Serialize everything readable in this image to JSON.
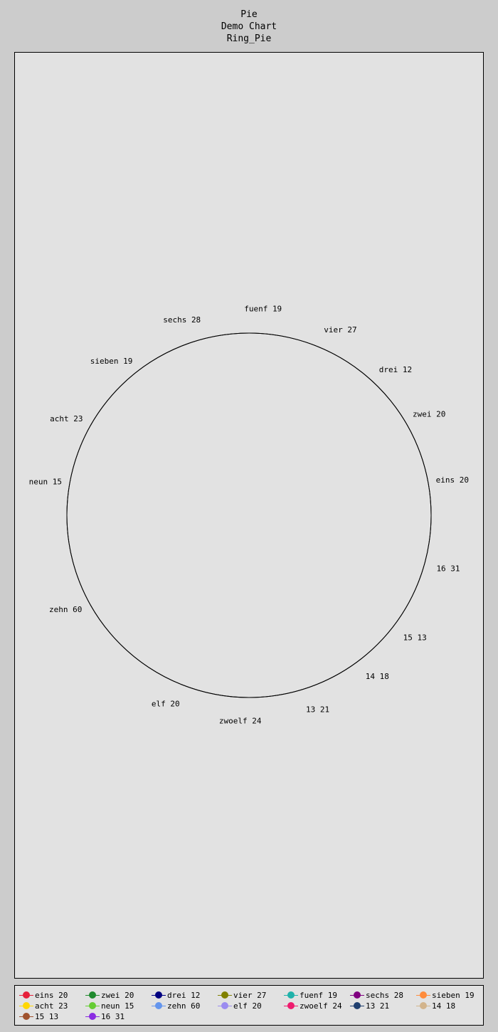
{
  "chart_data": {
    "type": "pie",
    "title": "Pie",
    "subtitle": [
      "Demo Chart",
      "Ring_Pie"
    ],
    "ring": true,
    "categories": [
      "eins",
      "zwei",
      "drei",
      "vier",
      "fuenf",
      "sechs",
      "sieben",
      "acht",
      "neun",
      "zehn",
      "elf",
      "zwoelf",
      "13",
      "14",
      "15",
      "16"
    ],
    "values": [
      20,
      20,
      12,
      27,
      19,
      28,
      19,
      23,
      15,
      60,
      20,
      24,
      21,
      18,
      13,
      31
    ],
    "labels": [
      "eins 20",
      "zwei 20",
      "drei 12",
      "vier 27",
      "fuenf 19",
      "sechs 28",
      "sieben 19",
      "acht 23",
      "neun 15",
      "zehn 60",
      "elf 20",
      "zwoelf 24",
      "13 21",
      "14 18",
      "15 13",
      "16 31"
    ],
    "colors": [
      "#e6203a",
      "#1f8a2e",
      "#000080",
      "#808000",
      "#20b2aa",
      "#800080",
      "#ff8c3c",
      "#ffd700",
      "#66cc33",
      "#6495ed",
      "#9b8cf0",
      "#ee1c6e",
      "#1f3f6f",
      "#d2b48c",
      "#a0522d",
      "#8a2be2"
    ],
    "start_angle_deg": 0,
    "legend_position": "bottom"
  }
}
